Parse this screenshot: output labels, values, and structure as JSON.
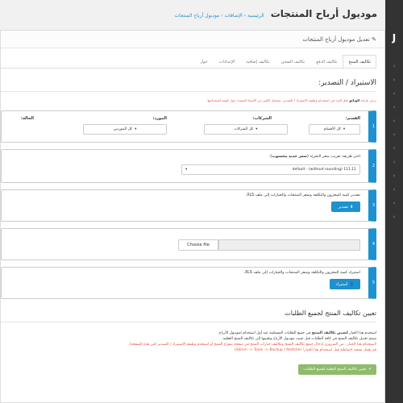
{
  "header": {
    "title": "موديول أرباح المنتجات",
    "breadcrumb": [
      "الرئيسية",
      "الإضافات",
      "موديول أرباح المنتجات"
    ]
  },
  "sidebar": {
    "logo": "J"
  },
  "panel": {
    "title": "تعديل موديول أرباح المنتجات"
  },
  "tabs": [
    "تكاليف المنتج",
    "تكاليف الدفع",
    "تكاليف الشحن",
    "تكاليف إضافية",
    "الإعدادات",
    "حول"
  ],
  "import_export": {
    "title": "الاستيراد / التصدير:",
    "warning_prefix": "يرجى قراءة",
    "warning_bold": "الوثائق",
    "warning_rest": "قبل البدء في استخدام وظيفة الاستيراد / التصدير. سنجعل الكثير من الأشياء المفيدة حول كيفية استخدامها.",
    "step1": {
      "category_label": "القسم:",
      "category_value": "كل الأقسام",
      "manufacturer_label": "الشركات:",
      "manufacturer_value": "كل الشركات",
      "supplier_label": "المورد:",
      "supplier_value": "كل الموردين",
      "status_label": "الحالة:"
    },
    "step2": {
      "label_prefix": "اختر طريقة تقريب سعر التجزئة (",
      "label_bold": "سعر جديد محسوب",
      "label_suffix": "):",
      "select_value": "default - (without rounding) 111.11"
    },
    "step3": {
      "text": "تصدير كمية المخزون والتكلفة وسعر المنتجات والخيارات إلى ملف XLS.",
      "button": "تصدير"
    },
    "step4": {
      "file_button": "Choose file"
    },
    "step5": {
      "text": "استيراد كمية المخزون والتكلفة وسعر المنتجات والخيارات إلى ملف XLS.",
      "button": "استيراد"
    }
  },
  "assign": {
    "title": "تعيين تكاليف المنتج لجميع الطلبات",
    "line1_prefix": "استخدم هذا الخيار",
    "line1_bold": "لتعيين تكاليف المنتج",
    "line1_rest": "في جميع الطلبات المستلمة عند أول استخدام لموديول الأرباح.",
    "line2": "سيتم تعديل تكاليف المنتج في كافة الطلبات قبل تثبيت موديول الأرباح وتعيينها إلى تكاليف المنتج الفعلية.",
    "line3": "لاستخدام هذا الخيار ، من الضروري إدخال جميع تكاليف المنتج وتكاليف خيارات المنتج في صفحة نموذج المنتج أو استخدم وظيفة الاستيراد / التصدير (في هذه الصفحة).",
    "line4": "قم بعمل نسخه احتياطية قبل استخدام هذا الخيار! (Admin -> Tools -> Backup / Restore)",
    "button": "تعيين تكاليف المنتج الفعلية لجميع الطلبات"
  },
  "colors": {
    "primary": "#1e91cf",
    "success": "#8fbb6c",
    "danger": "#e3503e"
  }
}
